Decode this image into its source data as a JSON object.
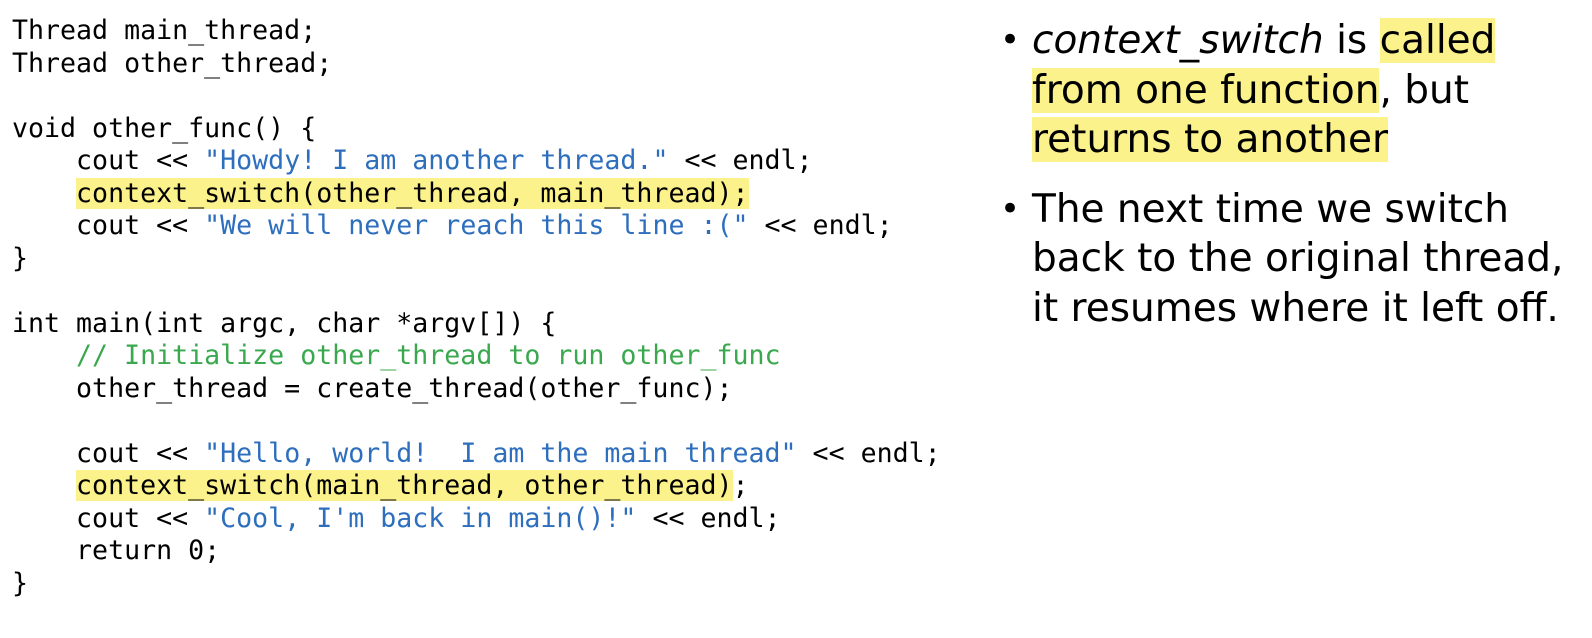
{
  "code_lines": [
    [
      {
        "t": "Thread main_thread;",
        "k": ""
      }
    ],
    [
      {
        "t": "Thread other_thread;",
        "k": ""
      }
    ],
    [
      {
        "t": "",
        "k": ""
      }
    ],
    [
      {
        "t": "void other_func() {",
        "k": ""
      }
    ],
    [
      {
        "t": "    cout << ",
        "k": ""
      },
      {
        "t": "\"Howdy! I am another thread.\"",
        "k": "str"
      },
      {
        "t": " << endl;",
        "k": ""
      }
    ],
    [
      {
        "t": "    ",
        "k": ""
      },
      {
        "t": "context_switch(other_thread, main_thread);",
        "k": "hl"
      }
    ],
    [
      {
        "t": "    cout << ",
        "k": ""
      },
      {
        "t": "\"We will never reach this line :(\"",
        "k": "str"
      },
      {
        "t": " << endl;",
        "k": ""
      }
    ],
    [
      {
        "t": "}",
        "k": ""
      }
    ],
    [
      {
        "t": "",
        "k": ""
      }
    ],
    [
      {
        "t": "int main(int argc, char *argv[]) {",
        "k": ""
      }
    ],
    [
      {
        "t": "    ",
        "k": ""
      },
      {
        "t": "// Initialize other_thread to run other_func",
        "k": "cmt"
      }
    ],
    [
      {
        "t": "    other_thread = create_thread(other_func);",
        "k": ""
      }
    ],
    [
      {
        "t": "",
        "k": ""
      }
    ],
    [
      {
        "t": "    cout << ",
        "k": ""
      },
      {
        "t": "\"Hello, world!  I am the main thread\"",
        "k": "str"
      },
      {
        "t": " << endl;",
        "k": ""
      }
    ],
    [
      {
        "t": "    ",
        "k": ""
      },
      {
        "t": "context_switch(main_thread, other_thread)",
        "k": "hl"
      },
      {
        "t": ";",
        "k": ""
      }
    ],
    [
      {
        "t": "    cout << ",
        "k": ""
      },
      {
        "t": "\"Cool, I'm back in main()!\"",
        "k": "str"
      },
      {
        "t": " << endl;",
        "k": ""
      }
    ],
    [
      {
        "t": "    return 0;",
        "k": ""
      }
    ],
    [
      {
        "t": "}",
        "k": ""
      }
    ]
  ],
  "bullets": [
    [
      {
        "t": "context_switch",
        "k": "em"
      },
      {
        "t": " is ",
        "k": ""
      },
      {
        "t": "called from one function",
        "k": "hl"
      },
      {
        "t": ", but ",
        "k": ""
      },
      {
        "t": "returns to another",
        "k": "hl"
      }
    ],
    [
      {
        "t": "The next time we switch back to the original thread, it resumes where it left off.",
        "k": ""
      }
    ]
  ],
  "bullet_symbol": "•",
  "colors": {
    "string": "#2d6ebd",
    "comment": "#3aa84e",
    "highlight": "#fbf28b"
  }
}
